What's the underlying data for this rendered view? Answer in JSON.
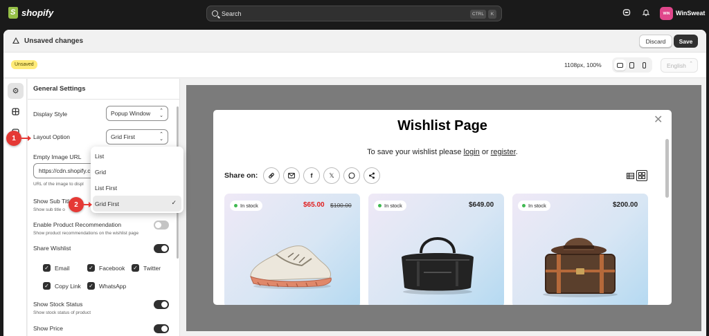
{
  "app": {
    "logo_text": "shopify",
    "search_placeholder": "Search",
    "search_shortcut": [
      "CTRL",
      "K"
    ],
    "store_initials": "WIN",
    "store_name": "WinSweat"
  },
  "editor": {
    "title": "Unsaved changes",
    "discard_label": "Discard",
    "save_label": "Save",
    "status_badge": "Unsaved",
    "viewport_info": "1108px, 100%",
    "language": "English"
  },
  "panel": {
    "title": "General Settings",
    "display_style": {
      "label": "Display Style",
      "value": "Popup Window"
    },
    "layout_option": {
      "label": "Layout Option",
      "value": "Grid First"
    },
    "empty_image": {
      "label": "Empty Image URL",
      "value": "https://cdn.shopify.c",
      "hint": "URL of the image to displ"
    },
    "show_sub_title": {
      "label": "Show Sub Titl",
      "hint": "Show sub title o"
    },
    "product_recommendation": {
      "label": "Enable Product Recommendation",
      "hint": "Show product recommendations on the wishlist page",
      "enabled": false
    },
    "share_wishlist": {
      "label": "Share Wishlist",
      "enabled": true
    },
    "share_options": [
      {
        "label": "Email",
        "checked": true
      },
      {
        "label": "Facebook",
        "checked": true
      },
      {
        "label": "Twitter",
        "checked": true
      },
      {
        "label": "Copy Link",
        "checked": true
      },
      {
        "label": "WhatsApp",
        "checked": true
      }
    ],
    "stock_status": {
      "label": "Show Stock Status",
      "hint": "Show stock status of product",
      "enabled": true
    },
    "show_price": {
      "label": "Show Price",
      "enabled": true
    }
  },
  "dropdown": {
    "options": [
      "List",
      "Grid",
      "List First",
      "Grid First"
    ],
    "selected": "Grid First"
  },
  "annotations": [
    "1",
    "2"
  ],
  "preview": {
    "title": "Wishlist Page",
    "message_prefix": "To save your wishlist please ",
    "login_link": "login",
    "message_middle": " or ",
    "register_link": "register",
    "message_suffix": ".",
    "share_label": "Share on:",
    "share_icons": [
      "link-icon",
      "email-icon",
      "facebook-icon",
      "x-icon",
      "whatsapp-icon",
      "share-icon"
    ],
    "products": [
      {
        "stock": "In stock",
        "price": "$65.00",
        "compare_price": "$100.00",
        "on_sale": true,
        "image": "sneaker"
      },
      {
        "stock": "In stock",
        "price": "$649.00",
        "compare_price": "",
        "on_sale": false,
        "image": "duffel-bag"
      },
      {
        "stock": "In stock",
        "price": "$200.00",
        "compare_price": "",
        "on_sale": false,
        "image": "hat-and-trunk"
      }
    ]
  },
  "colors": {
    "topbar": "#1a1a1a",
    "badge_unsaved": "#ffeb78",
    "store_badge": "#e0478b",
    "marker": "#e53935",
    "sale_price": "#e02020",
    "in_stock_dot": "#3fb950"
  }
}
